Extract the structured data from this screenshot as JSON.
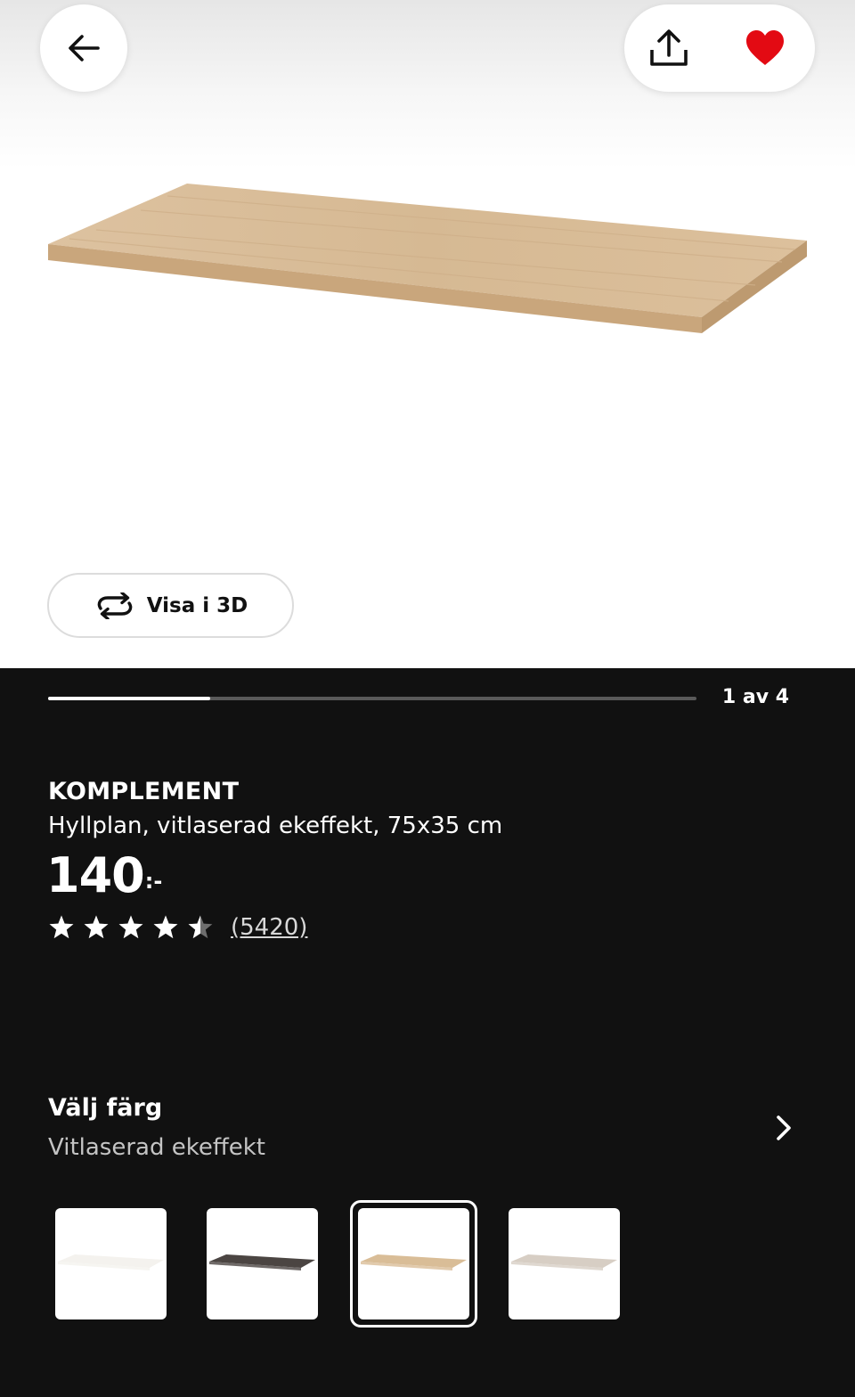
{
  "header": {
    "back_icon": "arrow-left-icon",
    "share_icon": "share-icon",
    "favorite_icon": "heart-icon",
    "favorite_color": "#e00751"
  },
  "media": {
    "view_3d_label": "Visa i 3D",
    "view_3d_icon": "rotate-icon",
    "carousel": {
      "current": 1,
      "total": 4,
      "counter_label": "1 av 4",
      "progress_fraction": 0.25
    }
  },
  "product": {
    "name": "KOMPLEMENT",
    "description": "Hyllplan, vitlaserad ekeffekt, 75x35 cm",
    "price_integer": "140",
    "price_suffix": ":-",
    "rating_value": 4.5,
    "rating_max": 5,
    "review_count_label": "(5420)"
  },
  "color_picker": {
    "heading": "Välj färg",
    "selected_label": "Vitlaserad ekeffekt",
    "chevron_icon": "chevron-right-icon",
    "options": [
      {
        "name": "white",
        "color": "#f4f2ee",
        "selected": false
      },
      {
        "name": "black-brown",
        "color": "#4b4542",
        "selected": false
      },
      {
        "name": "white-stained-oak",
        "color": "#d9bd97",
        "selected": true
      },
      {
        "name": "light-beige",
        "color": "#d7cec4",
        "selected": false
      }
    ]
  },
  "colors": {
    "background_dark": "#111111",
    "accent_white": "#ffffff"
  }
}
